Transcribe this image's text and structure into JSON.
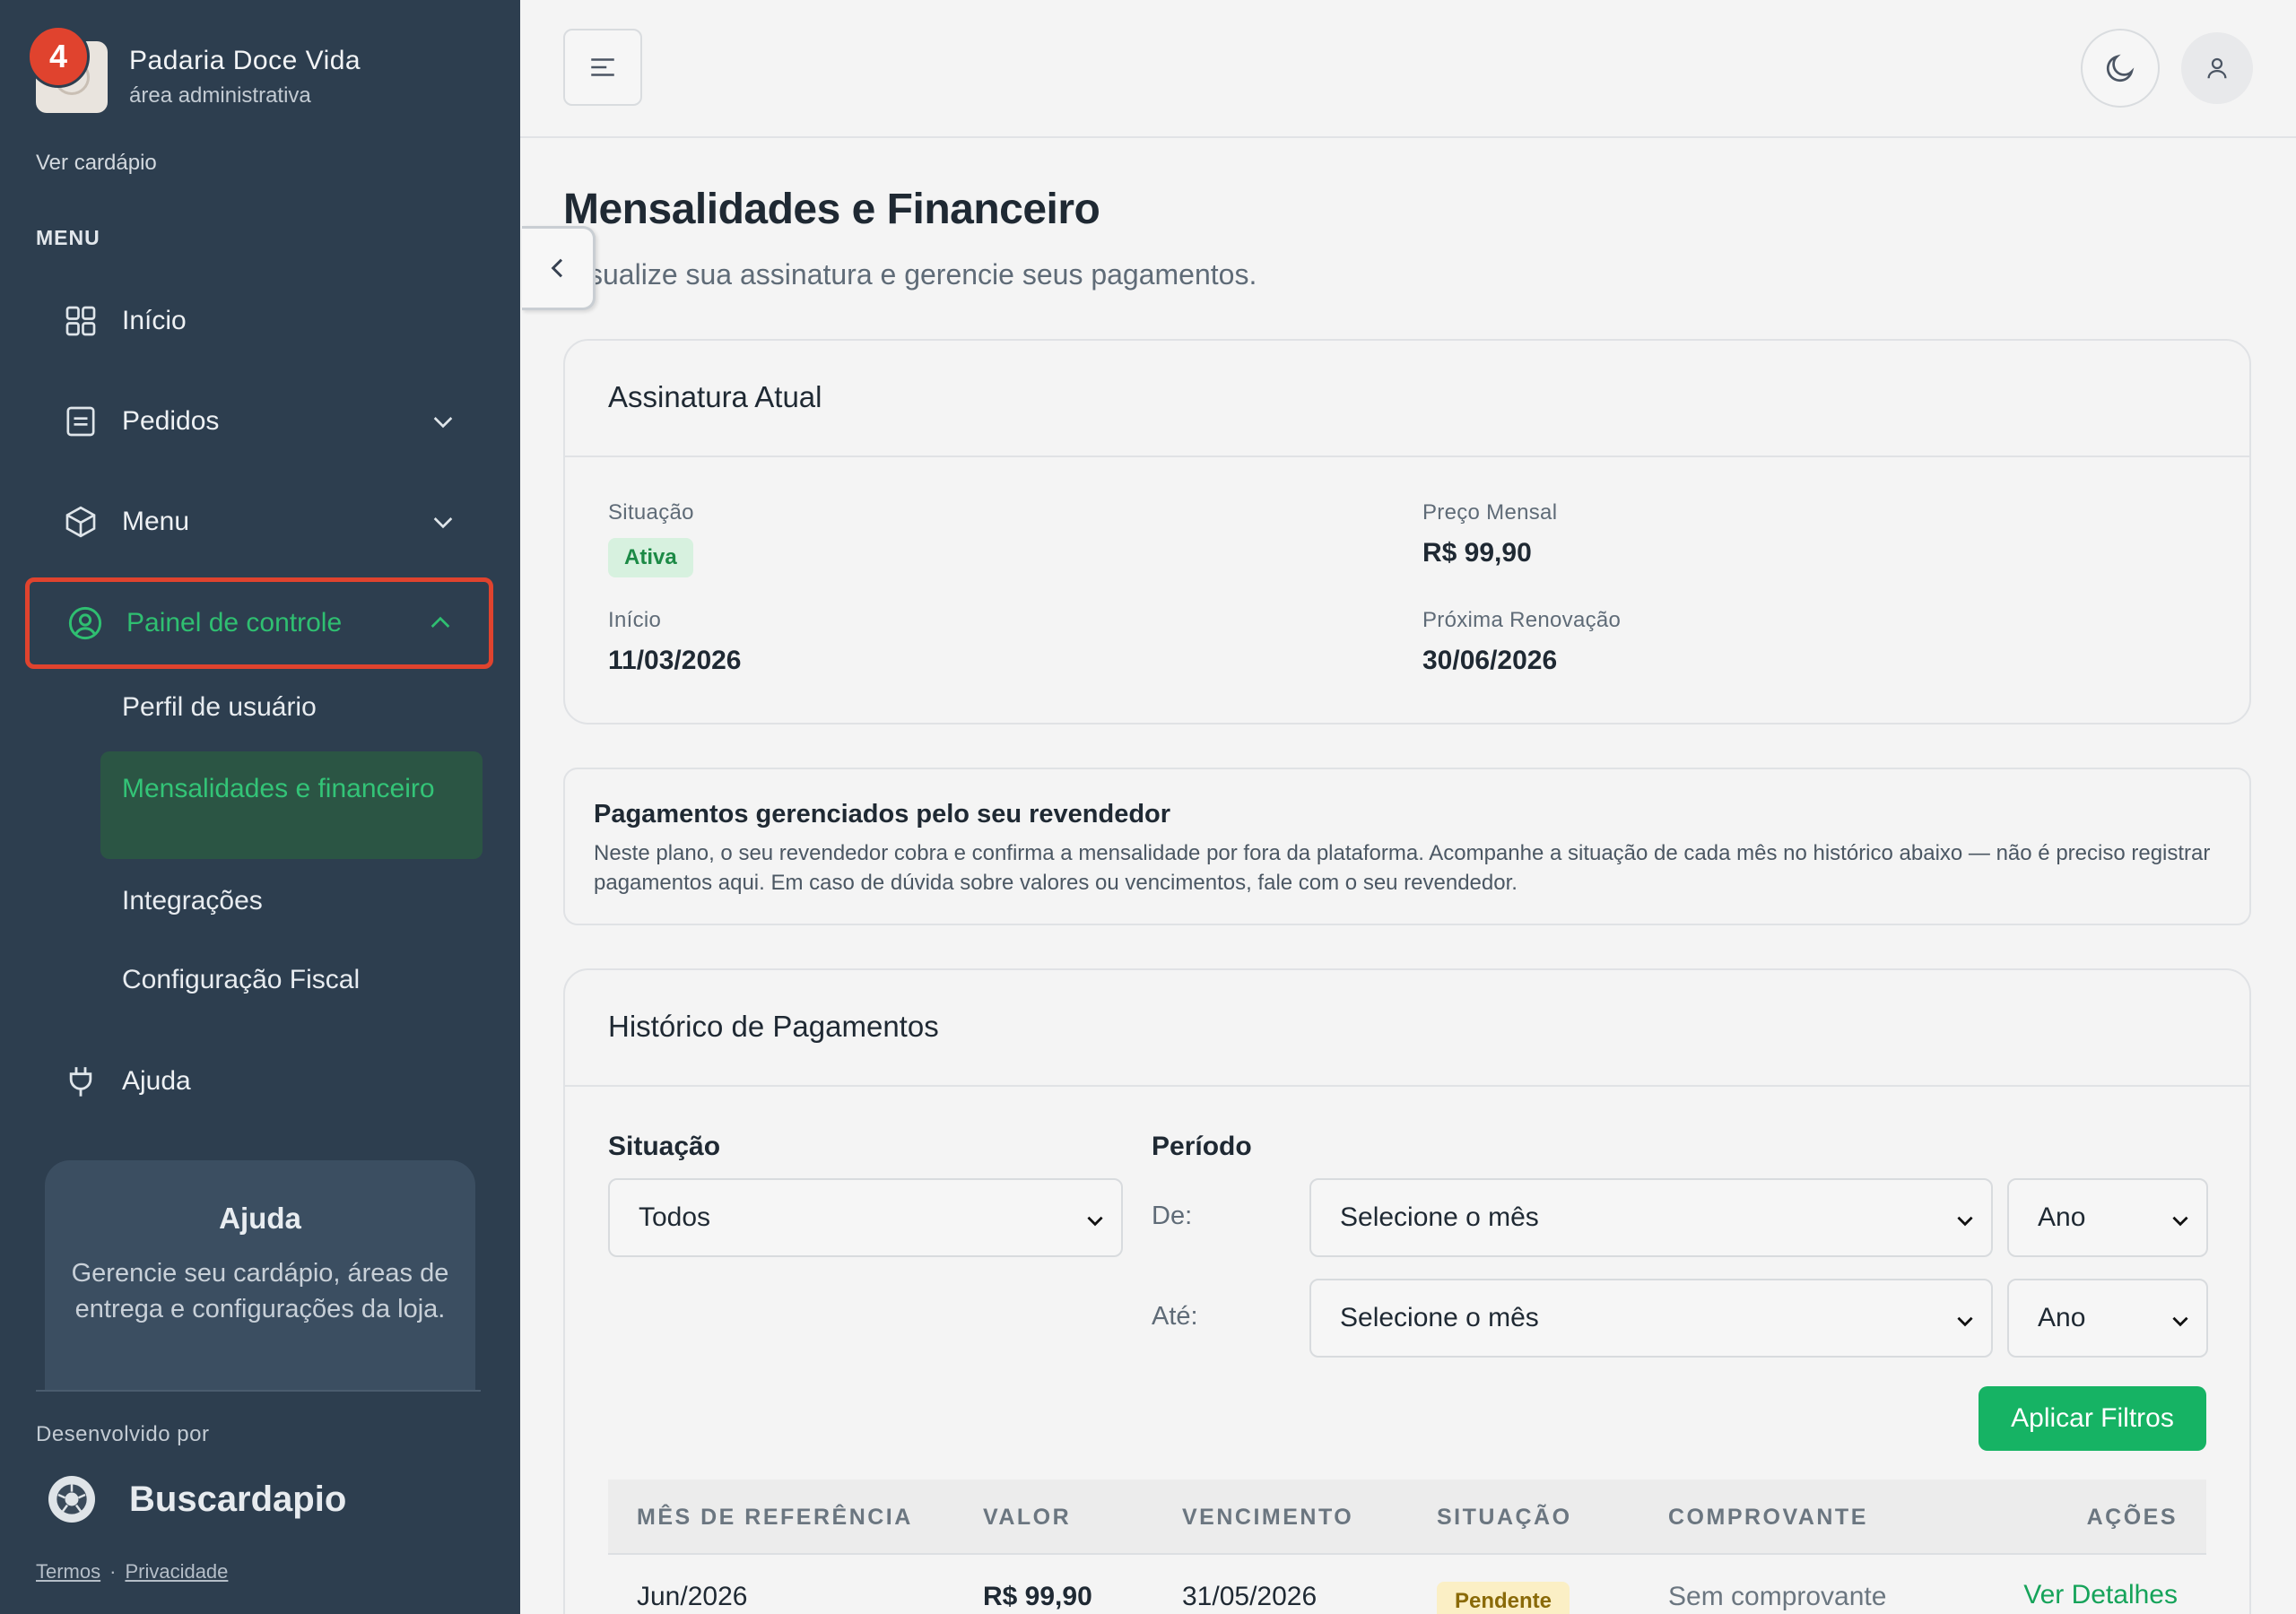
{
  "brand": {
    "name": "Padaria Doce Vida",
    "subtitle": "área administrativa",
    "notification_count": "4",
    "view_menu_link": "Ver cardápio"
  },
  "sidebar": {
    "menu_heading": "MENU",
    "items": [
      {
        "label": "Início",
        "icon": "grid-icon"
      },
      {
        "label": "Pedidos",
        "icon": "receipt-icon",
        "expandable": true
      },
      {
        "label": "Menu",
        "icon": "box-icon",
        "expandable": true
      },
      {
        "label": "Painel de controle",
        "icon": "user-circle-icon",
        "expanded": true,
        "active": true
      },
      {
        "label": "Ajuda",
        "icon": "plug-icon"
      }
    ],
    "subitems": [
      {
        "label": "Perfil de usuário"
      },
      {
        "label": "Mensalidades e financeiro",
        "active": true
      },
      {
        "label": "Integrações"
      },
      {
        "label": "Configuração Fiscal"
      }
    ],
    "help_box": {
      "title": "Ajuda",
      "text": "Gerencie seu cardápio, áreas de entrega e configurações da loja."
    },
    "developed_by": "Desenvolvido por",
    "developer_name": "Buscardapio",
    "footer_links": {
      "terms": "Termos",
      "privacy": "Privacidade"
    }
  },
  "page": {
    "title": "Mensalidades e Financeiro",
    "subtitle": "sualize sua assinatura e gerencie seus pagamentos."
  },
  "subscription": {
    "heading": "Assinatura Atual",
    "status_label": "Situação",
    "status_value": "Ativa",
    "price_label": "Preço Mensal",
    "price_value": "R$ 99,90",
    "start_label": "Início",
    "start_value": "11/03/2026",
    "renewal_label": "Próxima Renovação",
    "renewal_value": "30/06/2026"
  },
  "reseller_info": {
    "title": "Pagamentos gerenciados pelo seu revendedor",
    "text": "Neste plano, o seu revendedor cobra e confirma a mensalidade por fora da plataforma. Acompanhe a situação de cada mês no histórico abaixo — não é preciso registrar pagamentos aqui. Em caso de dúvida sobre valores ou vencimentos, fale com o seu revendedor."
  },
  "history": {
    "heading": "Histórico de Pagamentos",
    "filters": {
      "status_label": "Situação",
      "status_value": "Todos",
      "period_label": "Período",
      "from_label": "De:",
      "to_label": "Até:",
      "month_placeholder": "Selecione o mês",
      "year_placeholder": "Ano",
      "apply_button": "Aplicar Filtros"
    },
    "columns": [
      "MÊS DE REFERÊNCIA",
      "VALOR",
      "VENCIMENTO",
      "SITUAÇÃO",
      "COMPROVANTE",
      "AÇÕES"
    ],
    "rows": [
      {
        "month": "Jun/2026",
        "amount": "R$ 99,90",
        "due": "31/05/2026",
        "status": "Pendente",
        "receipt": "Sem comprovante",
        "action": "Ver Detalhes"
      }
    ]
  },
  "colors": {
    "sidebar_bg": "#2d3e4f",
    "accent_green": "#16b364",
    "active_outline": "#e0432e",
    "badge_red": "#e0432e"
  }
}
